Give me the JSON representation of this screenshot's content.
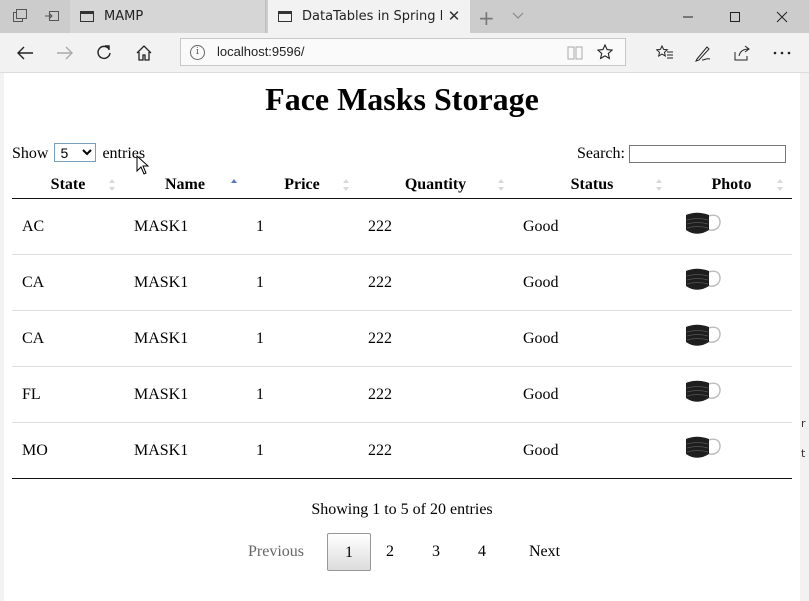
{
  "browser": {
    "tabs": [
      {
        "label": "MAMP",
        "active": false
      },
      {
        "label": "DataTables in Spring MVC",
        "active": true
      }
    ],
    "url": "localhost:9596/"
  },
  "page": {
    "title": "Face Masks Storage",
    "length_menu": {
      "show": "Show",
      "selected": "5",
      "entries": "entries"
    },
    "search": {
      "label": "Search:",
      "value": ""
    },
    "columns": [
      {
        "label": "State",
        "sort": "none"
      },
      {
        "label": "Name",
        "sort": "asc"
      },
      {
        "label": "Price",
        "sort": "none"
      },
      {
        "label": "Quantity",
        "sort": "none"
      },
      {
        "label": "Status",
        "sort": "none"
      },
      {
        "label": "Photo",
        "sort": "none"
      }
    ],
    "rows": [
      {
        "state": "AC",
        "name": "MASK1",
        "price": "1",
        "quantity": "222",
        "status": "Good",
        "photo": "face-mask-image"
      },
      {
        "state": "CA",
        "name": "MASK1",
        "price": "1",
        "quantity": "222",
        "status": "Good",
        "photo": "face-mask-image"
      },
      {
        "state": "CA",
        "name": "MASK1",
        "price": "1",
        "quantity": "222",
        "status": "Good",
        "photo": "face-mask-image"
      },
      {
        "state": "FL",
        "name": "MASK1",
        "price": "1",
        "quantity": "222",
        "status": "Good",
        "photo": "face-mask-image"
      },
      {
        "state": "MO",
        "name": "MASK1",
        "price": "1",
        "quantity": "222",
        "status": "Good",
        "photo": "face-mask-image"
      }
    ],
    "info": "Showing 1 to 5 of 20 entries",
    "pagination": {
      "previous": "Previous",
      "pages": [
        "1",
        "2",
        "3",
        "4"
      ],
      "current": "1",
      "next": "Next"
    }
  },
  "colors": {
    "sort_active": "#5b76c6",
    "sort_inactive": "#d8d8d8"
  }
}
